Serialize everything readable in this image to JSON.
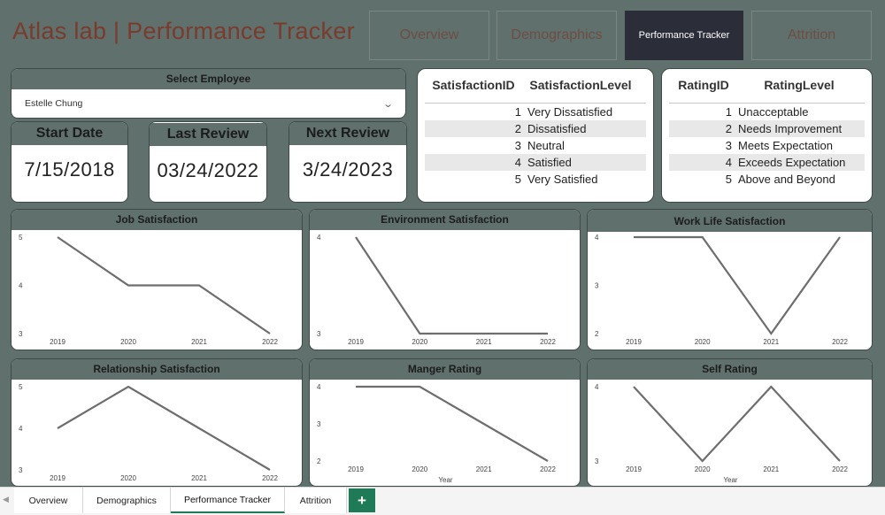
{
  "header": {
    "title": "Atlas lab | Performance Tracker"
  },
  "nav_tabs": [
    {
      "label": "Overview",
      "active": false
    },
    {
      "label": "Demographics",
      "active": false
    },
    {
      "label": "Performance Tracker",
      "active": true
    },
    {
      "label": "Attrition",
      "active": false
    }
  ],
  "employee_select": {
    "title": "Select Employee",
    "value": "Estelle Chung"
  },
  "dates": {
    "start": {
      "label": "Start Date",
      "value": "7/15/2018"
    },
    "last_review": {
      "label": "Last Review",
      "value": "03/24/2022"
    },
    "next_review": {
      "label": "Next Review",
      "value": "3/24/2023"
    }
  },
  "satisfaction_table": {
    "headers": [
      "SatisfactionID",
      "SatisfactionLevel"
    ],
    "rows": [
      {
        "id": "1",
        "level": "Very Dissatisfied"
      },
      {
        "id": "2",
        "level": "Dissatisfied"
      },
      {
        "id": "3",
        "level": "Neutral"
      },
      {
        "id": "4",
        "level": "Satisfied"
      },
      {
        "id": "5",
        "level": "Very Satisfied"
      }
    ]
  },
  "rating_table": {
    "headers": [
      "RatingID",
      "RatingLevel"
    ],
    "rows": [
      {
        "id": "1",
        "level": "Unacceptable"
      },
      {
        "id": "2",
        "level": "Needs Improvement"
      },
      {
        "id": "3",
        "level": "Meets Expectation"
      },
      {
        "id": "4",
        "level": "Exceeds Expectation"
      },
      {
        "id": "5",
        "level": "Above and Beyond"
      }
    ]
  },
  "chart_data": [
    {
      "type": "line",
      "title": "Job Satisfaction",
      "x": [
        "2019",
        "2020",
        "2021",
        "2022"
      ],
      "values": [
        5,
        4,
        4,
        3
      ],
      "yticks": [
        3,
        4,
        5
      ],
      "ylim": [
        3,
        5
      ],
      "xlabel": "",
      "line_color": "#6e6e6e"
    },
    {
      "type": "line",
      "title": "Environment Satisfaction",
      "x": [
        "2019",
        "2020",
        "2021",
        "2022"
      ],
      "values": [
        4,
        3,
        3,
        3
      ],
      "yticks": [
        3,
        4
      ],
      "ylim": [
        3,
        4
      ],
      "xlabel": "",
      "line_color": "#6e6e6e"
    },
    {
      "type": "line",
      "title": "Work Life Satisfaction",
      "x": [
        "2019",
        "2020",
        "2021",
        "2022"
      ],
      "values": [
        4,
        4,
        2,
        4
      ],
      "yticks": [
        2,
        3,
        4
      ],
      "ylim": [
        2,
        4
      ],
      "xlabel": "",
      "line_color": "#6e6e6e"
    },
    {
      "type": "line",
      "title": "Relationship Satisfaction",
      "x": [
        "2019",
        "2020",
        "2021",
        "2022"
      ],
      "values": [
        4,
        5,
        4,
        3
      ],
      "yticks": [
        3,
        4,
        5
      ],
      "ylim": [
        3,
        5
      ],
      "xlabel": "",
      "line_color": "#6e6e6e"
    },
    {
      "type": "line",
      "title": "Manger Rating",
      "x": [
        "2019",
        "2020",
        "2021",
        "2022"
      ],
      "values": [
        4,
        4,
        3,
        2
      ],
      "yticks": [
        2,
        3,
        4
      ],
      "ylim": [
        2,
        4
      ],
      "xlabel": "Year",
      "line_color": "#6e6e6e"
    },
    {
      "type": "line",
      "title": "Self Rating",
      "x": [
        "2019",
        "2020",
        "2021",
        "2022"
      ],
      "values": [
        4,
        3,
        4,
        3
      ],
      "yticks": [
        3,
        4
      ],
      "ylim": [
        3,
        4
      ],
      "xlabel": "Year",
      "line_color": "#6e6e6e"
    }
  ],
  "page_tabs": [
    {
      "label": "Overview",
      "active": false
    },
    {
      "label": "Demographics",
      "active": false
    },
    {
      "label": "Performance Tracker",
      "active": true
    },
    {
      "label": "Attrition",
      "active": false
    }
  ],
  "add_page": {
    "label": "+"
  },
  "icons": {
    "dropdown": "chevron-down-icon",
    "scroll": "scroll-left-icon",
    "add": "plus-icon"
  }
}
